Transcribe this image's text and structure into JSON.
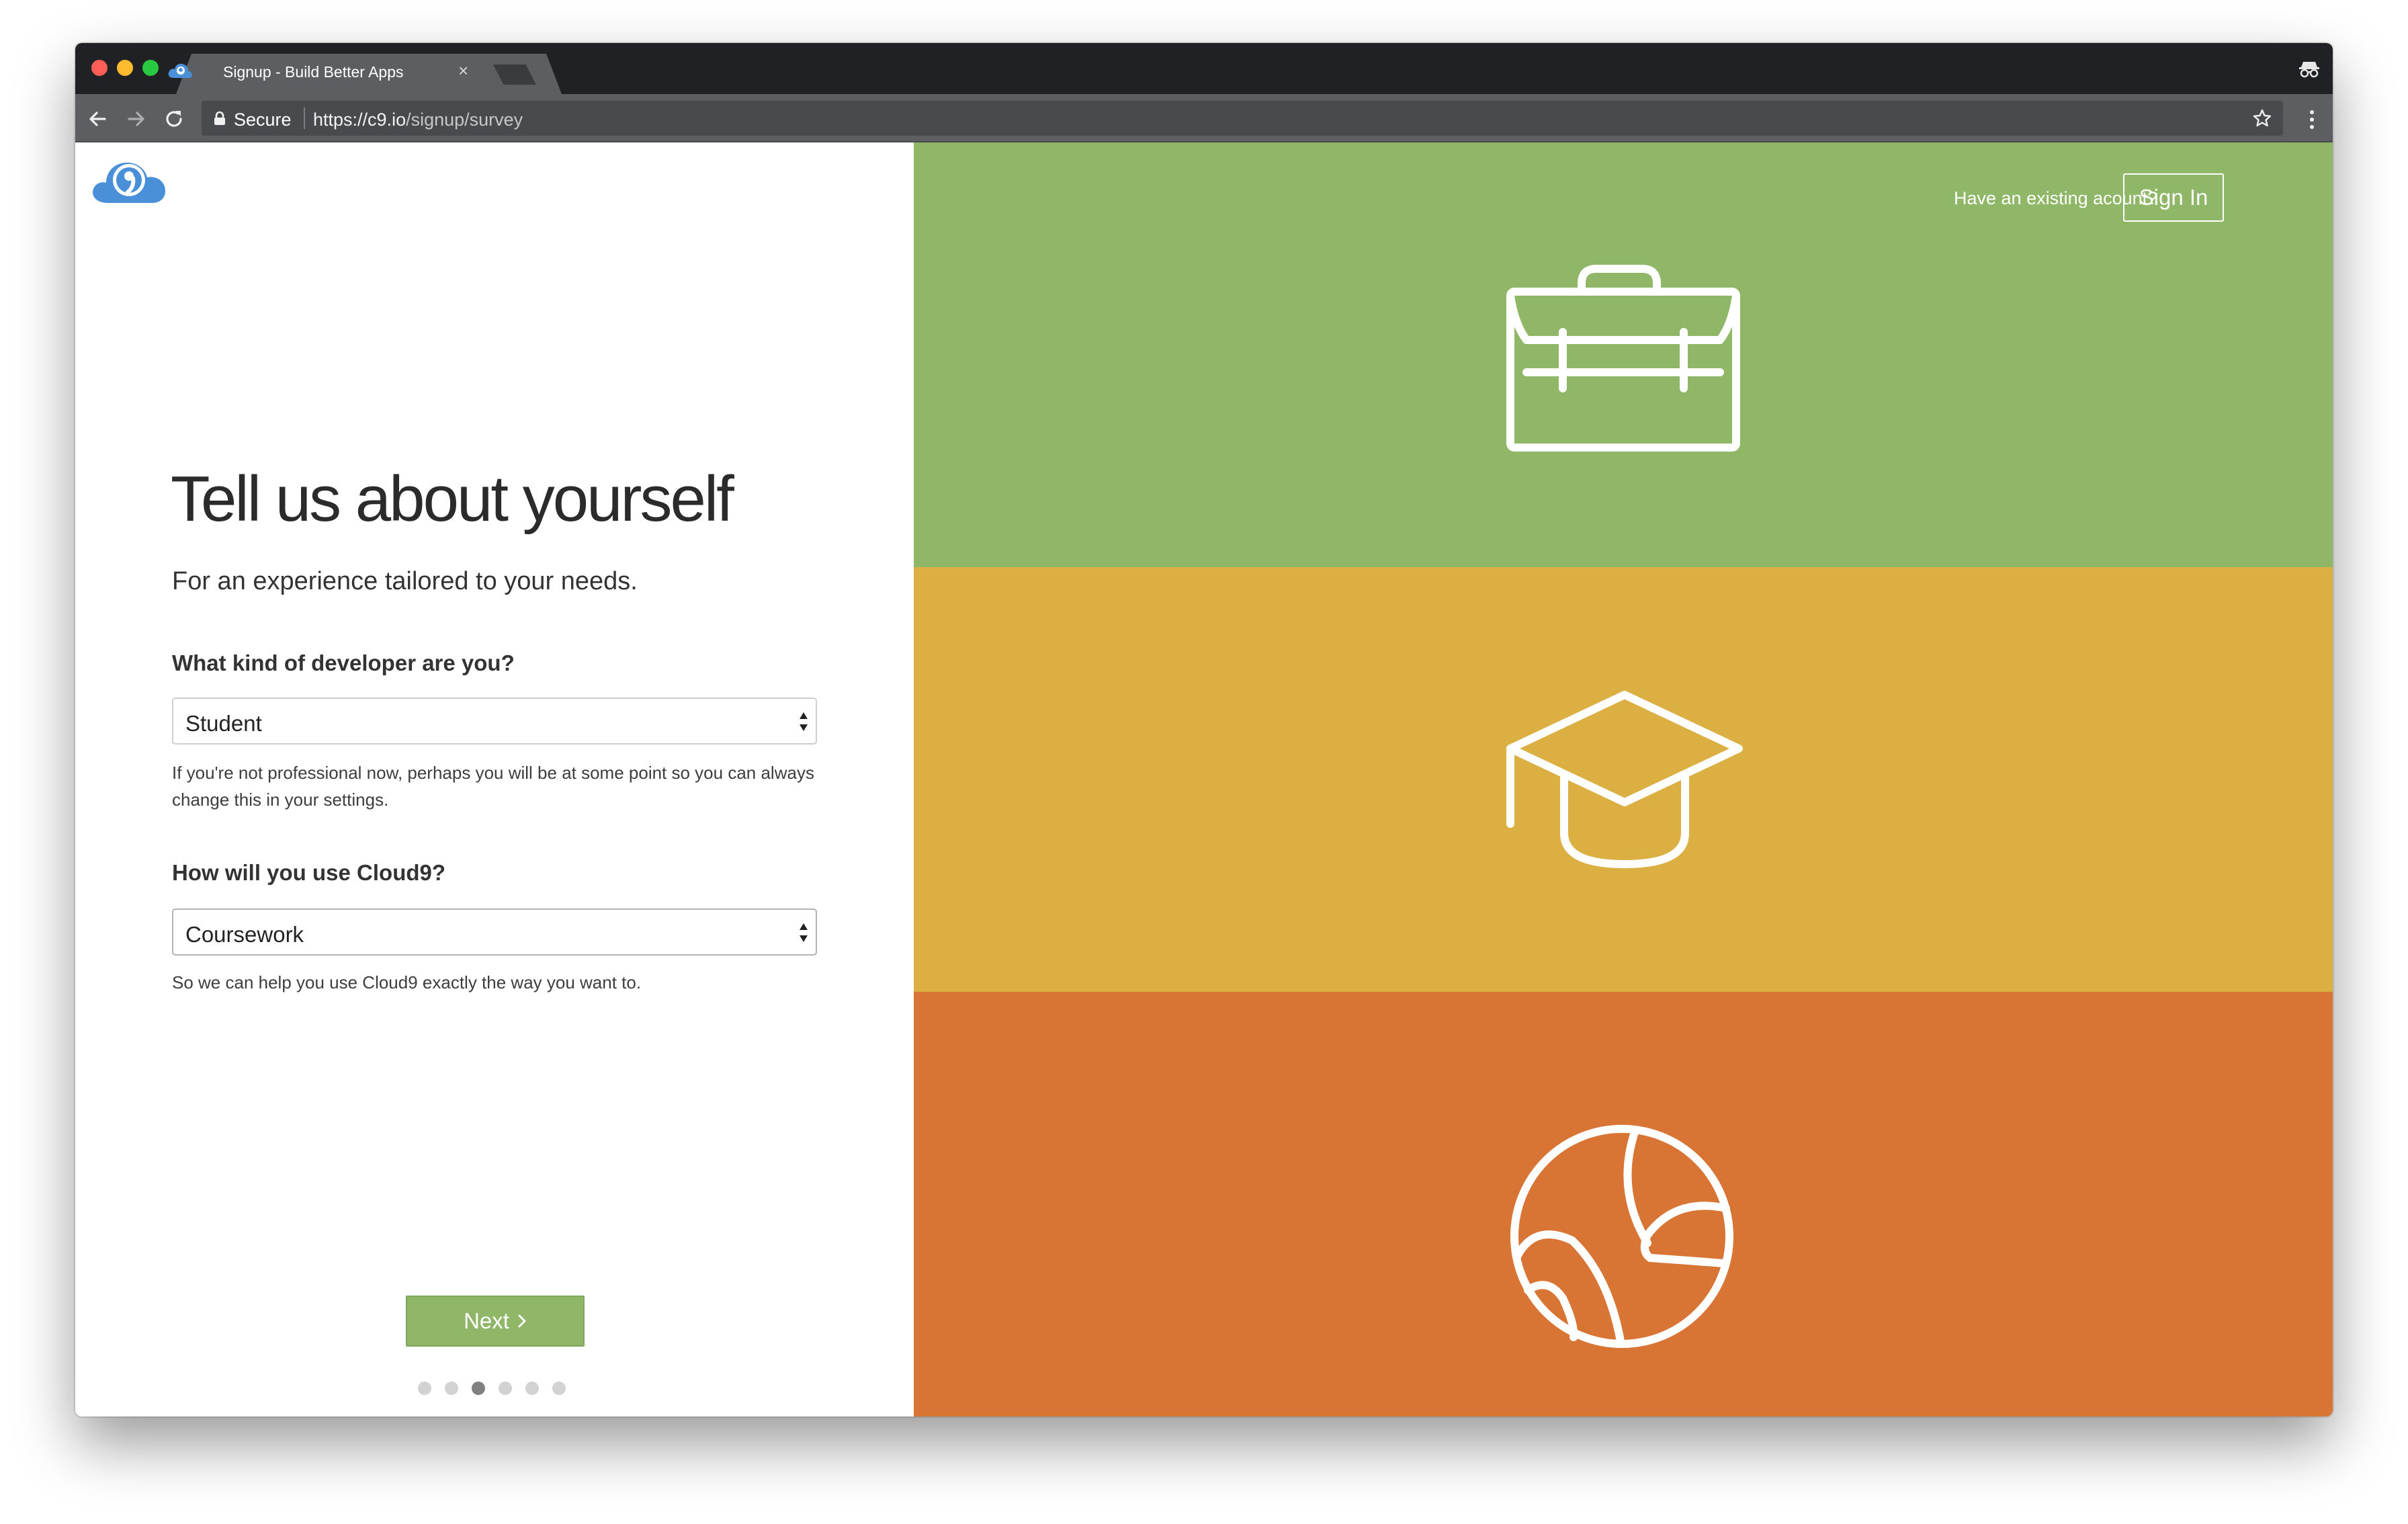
{
  "browser": {
    "tab_title": "Signup - Build Better Apps",
    "tab_close": "×",
    "secure_label": "Secure",
    "url_scheme": "https://",
    "url_host": "c9.io",
    "url_path": "/signup/survey",
    "icons": [
      "back-arrow-icon",
      "forward-arrow-icon",
      "reload-icon",
      "lock-icon",
      "bookmark-star-icon",
      "kebab-menu-icon",
      "incognito-icon",
      "cloud9-favicon-icon"
    ]
  },
  "page": {
    "logo_icon": "cloud9-logo-icon",
    "title": "Tell us about yourself",
    "subtitle": "For an experience tailored to your needs.",
    "question1": {
      "label": "What kind of developer are you?",
      "selected": "Student",
      "help": "If you're not professional now, perhaps you will be at some point so you can always change this in your settings."
    },
    "question2": {
      "label": "How will you use Cloud9?",
      "selected": "Coursework",
      "help": "So we can help you use Cloud9 exactly the way you want to."
    },
    "next_label": "Next",
    "progress": {
      "total_steps": 6,
      "current_step": 3
    }
  },
  "side": {
    "existing_account_text": "Have an existing acount?",
    "sign_in_label": "Sign In",
    "bands": [
      {
        "icon": "briefcase-icon",
        "color": "#8fb767"
      },
      {
        "icon": "graduation-cap-icon",
        "color": "#dcaf42"
      },
      {
        "icon": "basketball-icon",
        "color": "#d97534"
      }
    ]
  }
}
